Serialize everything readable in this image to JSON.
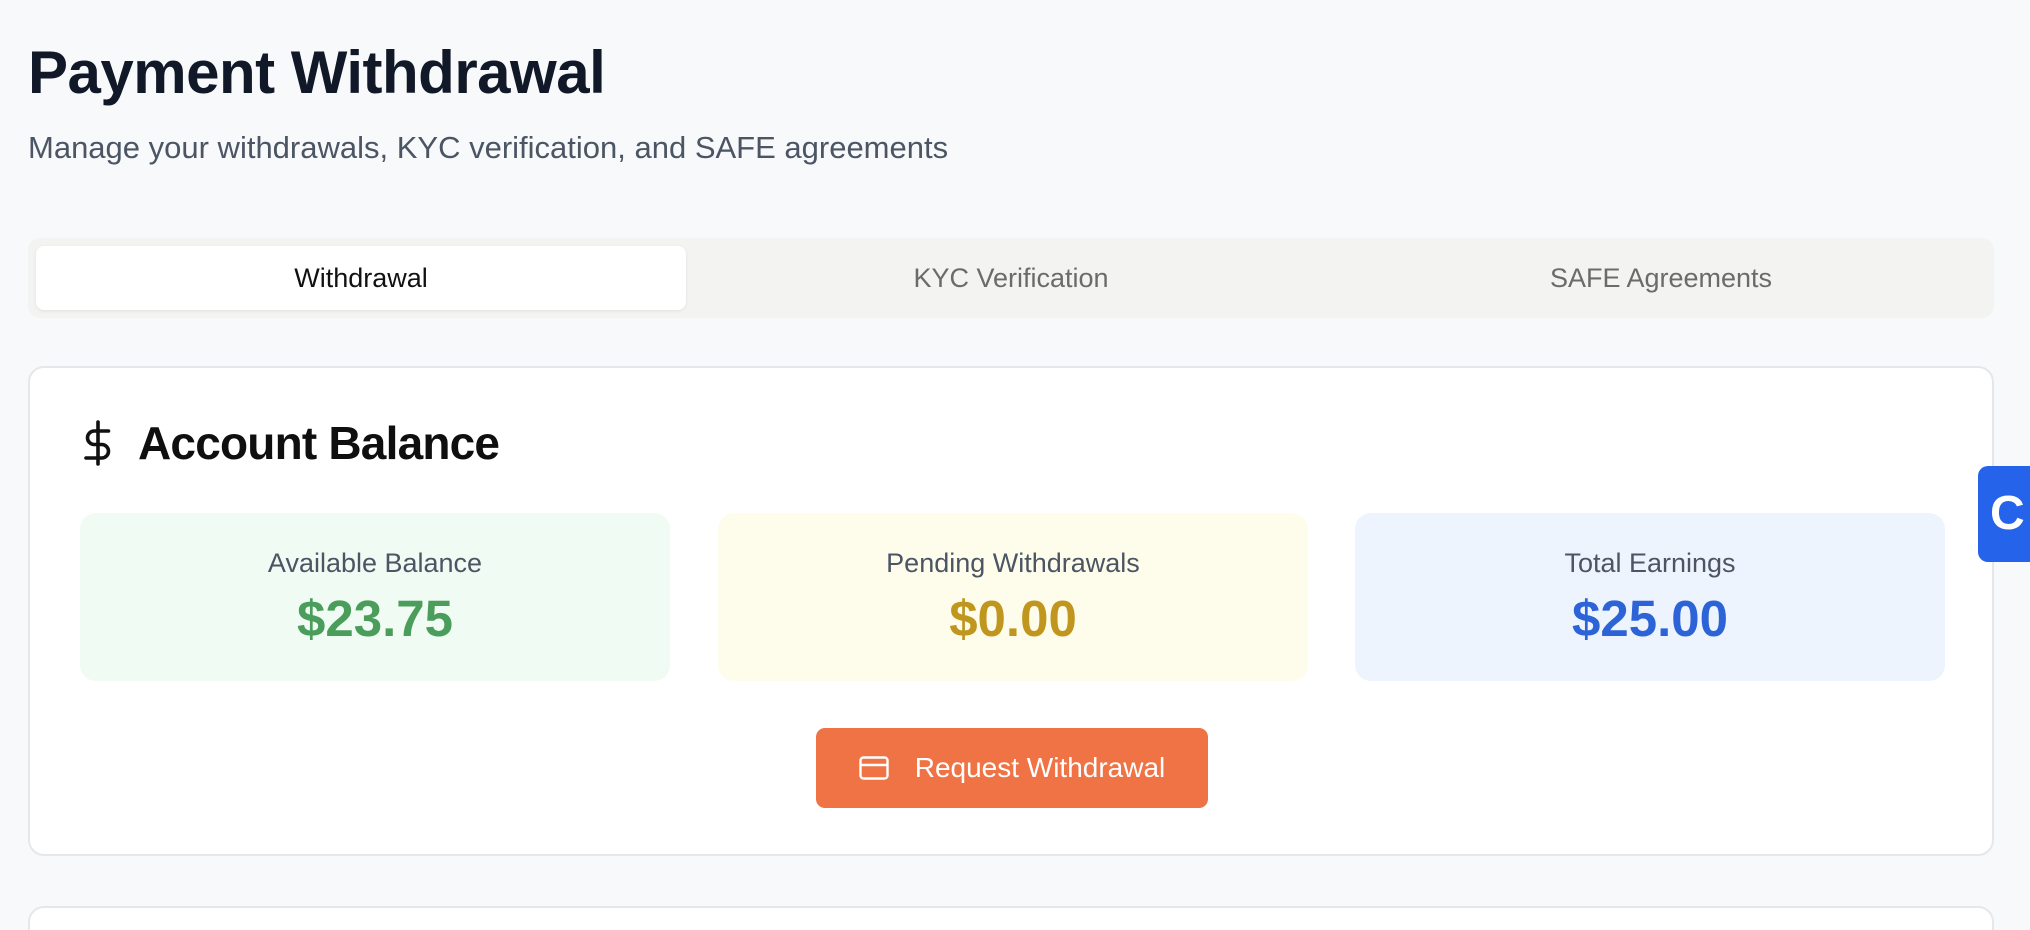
{
  "header": {
    "title": "Payment Withdrawal",
    "subtitle": "Manage your withdrawals, KYC verification, and SAFE agreements"
  },
  "tabs": [
    {
      "label": "Withdrawal",
      "active": true
    },
    {
      "label": "KYC Verification",
      "active": false
    },
    {
      "label": "SAFE Agreements",
      "active": false
    }
  ],
  "balance_card": {
    "icon": "dollar-icon",
    "title": "Account Balance",
    "stats": [
      {
        "label": "Available Balance",
        "value": "$23.75",
        "color": "#4a9d5b",
        "background": "#f0fbf3"
      },
      {
        "label": "Pending Withdrawals",
        "value": "$0.00",
        "color": "#c0961f",
        "background": "#fefdeb"
      },
      {
        "label": "Total Earnings",
        "value": "$25.00",
        "color": "#2c63d6",
        "background": "#eef4fe"
      }
    ],
    "action": {
      "icon": "credit-card-icon",
      "label": "Request Withdrawal",
      "color": "#ef7345"
    }
  },
  "side_widget": {
    "label": "C",
    "color": "#2563eb"
  }
}
